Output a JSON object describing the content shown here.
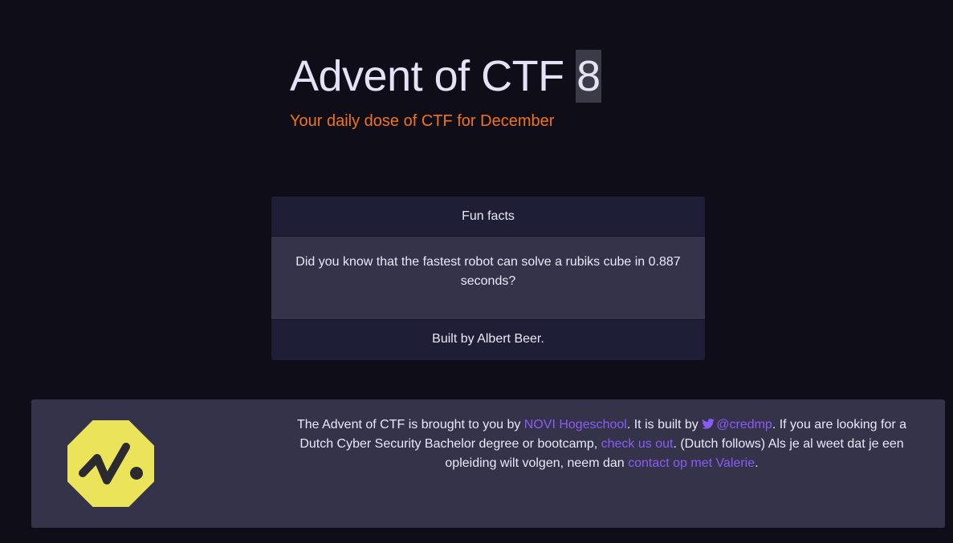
{
  "hero": {
    "title": "Advent of CTF",
    "day": "8",
    "subtitle": "Your daily dose of CTF for December"
  },
  "fun_facts": {
    "header": "Fun facts",
    "body": "Did you know that the fastest robot can solve a rubiks cube in 0.887 seconds?",
    "footer": "Built by Albert Beer."
  },
  "footer": {
    "logo_icon": "novi-octagon-logo-icon",
    "text_1": "The Advent of CTF is brought to you by ",
    "link_novi": "NOVI Hogeschool",
    "text_2": ". It is built by ",
    "twitter_icon": "twitter-icon",
    "link_twitter": "@credmp",
    "text_3": ". If you are looking for a Dutch Cyber Security Bachelor degree or bootcamp, ",
    "link_check": "check us out",
    "text_4": ". (Dutch follows) Als je al weet dat je een opleiding wilt volgen, neem dan ",
    "link_contact": "contact op met Valerie",
    "text_5": "."
  },
  "colors": {
    "background": "#0f0e18",
    "accent_orange": "#f0741a",
    "link_purple": "#8a5cf6",
    "panel": "#34334a",
    "panel_dark": "#1e1f36",
    "logo_yellow": "#ebe35a"
  }
}
